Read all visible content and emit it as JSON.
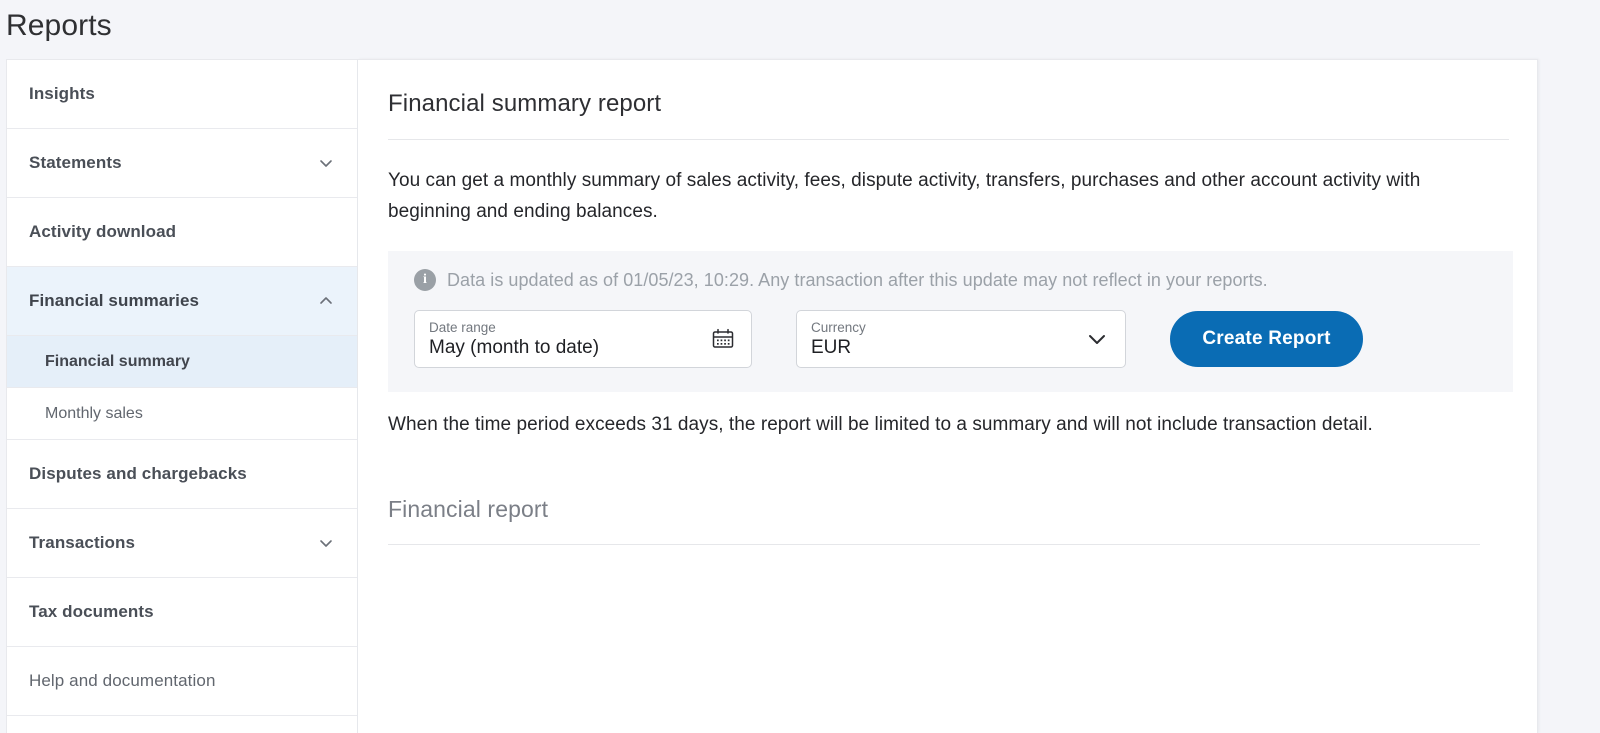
{
  "header": {
    "title": "Reports"
  },
  "sidebar": {
    "items": [
      {
        "label": "Insights",
        "chevron": "none",
        "state": "default"
      },
      {
        "label": "Statements",
        "chevron": "chevron-down-icon",
        "state": "default"
      },
      {
        "label": "Activity download",
        "chevron": "none",
        "state": "default"
      },
      {
        "label": "Financial summaries",
        "chevron": "chevron-up-icon",
        "state": "expanded"
      },
      {
        "label": "Disputes and chargebacks",
        "chevron": "none",
        "state": "default"
      },
      {
        "label": "Transactions",
        "chevron": "chevron-down-icon",
        "state": "default"
      },
      {
        "label": "Tax documents",
        "chevron": "none",
        "state": "default"
      },
      {
        "label": "Help and documentation",
        "chevron": "none",
        "state": "muted"
      }
    ],
    "subitems": [
      {
        "label": "Financial summary",
        "active": true
      },
      {
        "label": "Monthly sales",
        "active": false
      }
    ]
  },
  "main": {
    "section_title": "Financial summary report",
    "intro": "You can get a monthly summary of sales activity, fees, dispute activity, transfers, purchases and other account activity with beginning and ending balances.",
    "notice": {
      "icon": "info-icon",
      "text": "Data is updated as of 01/05/23, 10:29. Any transaction after this update may not reflect in your reports."
    },
    "controls": {
      "date_range": {
        "label": "Date range",
        "value": "May (month to date)",
        "icon": "calendar-icon"
      },
      "currency": {
        "label": "Currency",
        "value": "EUR",
        "icon": "chevron-down-icon"
      },
      "create_button": "Create Report"
    },
    "footnote": "When the time period exceeds 31 days, the report will be limited to a summary and will not include transaction detail.",
    "report_title": "Financial report"
  },
  "colors": {
    "accent": "#0a6cb4",
    "page_bg": "#f4f5f9",
    "panel_bg": "#f5f6f9",
    "active_nav": "#ebf3fb",
    "active_subnav": "#e5eff9"
  }
}
